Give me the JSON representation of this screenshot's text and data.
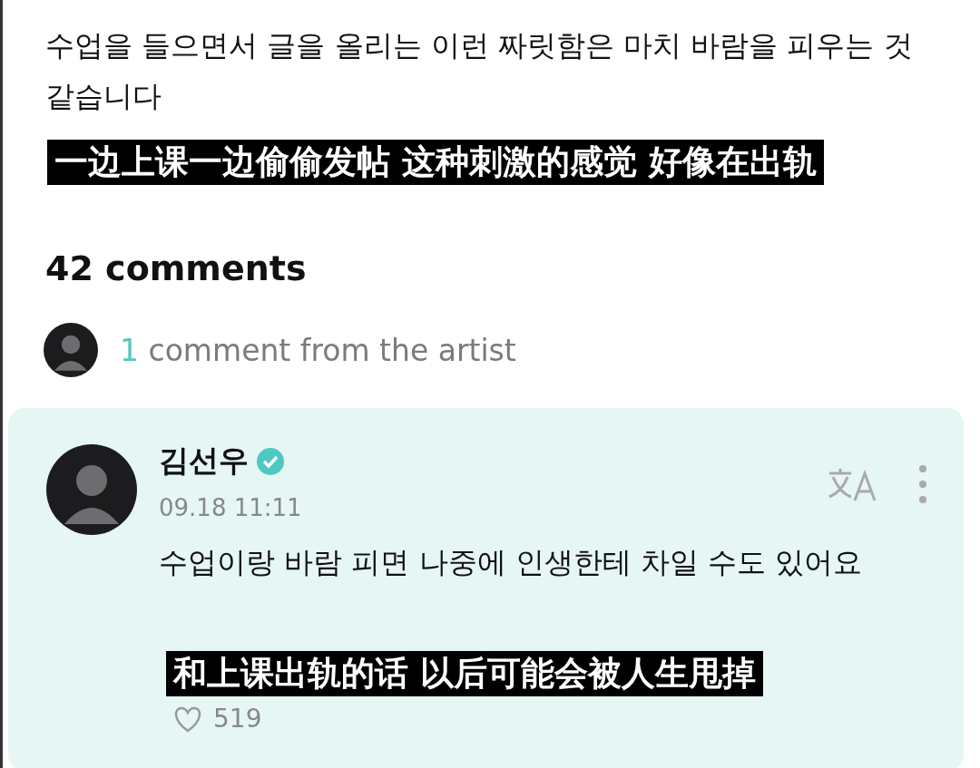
{
  "post": {
    "text": "수업을 들으면서 글을 올리는 이런 짜릿함은 마치 바람을 피우는 것 같습니다"
  },
  "subtitles": [
    "一边上课一边偷偷发帖 这种刺激的感觉 好像在出轨",
    "和上课出轨的话 以后可能会被人生甩掉"
  ],
  "comments_header": {
    "title": "42 comments",
    "artist_count": "1",
    "artist_label": "comment from the artist"
  },
  "comment": {
    "author": "김선우",
    "verified": true,
    "time": "09.18 11:11",
    "text": "수업이랑 바람 피면 나중에 인생한테 차일 수도 있어요",
    "likes": "519"
  }
}
